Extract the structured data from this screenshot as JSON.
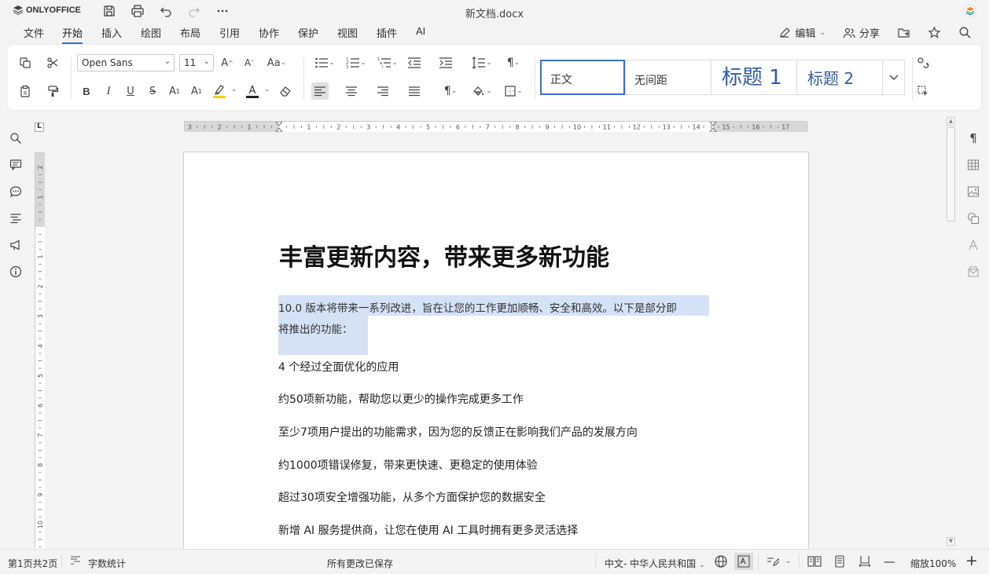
{
  "app": {
    "name": "ONLYOFFICE",
    "doc_title": "新文档.docx"
  },
  "menu": {
    "items": [
      "文件",
      "开始",
      "插入",
      "绘图",
      "布局",
      "引用",
      "协作",
      "保护",
      "视图",
      "插件",
      "AI"
    ],
    "active": "开始",
    "edit_label": "编辑",
    "share_label": "分享"
  },
  "toolbar": {
    "font_name": "Open Sans",
    "font_size": "11",
    "underline_color": "#f5d400",
    "font_color": "#d9342b"
  },
  "styles": {
    "normal": "正文",
    "no_spacing": "无间距",
    "heading1": "标题 1",
    "heading2": "标题 2"
  },
  "ruler": {
    "h_labels": [
      "3",
      "2",
      "1",
      "1",
      "2",
      "3",
      "4",
      "5",
      "6",
      "7",
      "8",
      "9",
      "10",
      "11",
      "12",
      "13",
      "14",
      "15",
      "16",
      "17"
    ],
    "v_labels": [
      "2",
      "1",
      "1",
      "2",
      "3",
      "4",
      "5",
      "6",
      "7",
      "8",
      "9",
      "10"
    ]
  },
  "document": {
    "heading": "丰富更新内容，带来更多新功能",
    "intro_line1": "10.0 版本将带来一系列改进，旨在让您的工作更加顺畅、安全和高效。以下是部分即",
    "intro_line2": "将推出的功能：",
    "items": [
      "4 个经过全面优化的应用",
      "约50项新功能，帮助您以更少的操作完成更多工作",
      "至少7项用户提出的功能需求，因为您的反馈正在影响我们产品的发展方向",
      "约1000项错误修复，带来更快速、更稳定的使用体验",
      "超过30项安全增强功能，从多个方面保护您的数据安全",
      "新增 AI 服务提供商，让您在使用 AI 工具时拥有更多灵活选择"
    ],
    "selection_color": "#d5e1f5"
  },
  "status": {
    "page_info": "第1页共2页",
    "word_count": "字数统计",
    "save_status": "所有更改已保存",
    "language": "中文- 中华人民共和国",
    "zoom": "缩放100%"
  },
  "colors": {
    "accent": "#3a6fd1",
    "heading_style": "#2f5d9e"
  }
}
